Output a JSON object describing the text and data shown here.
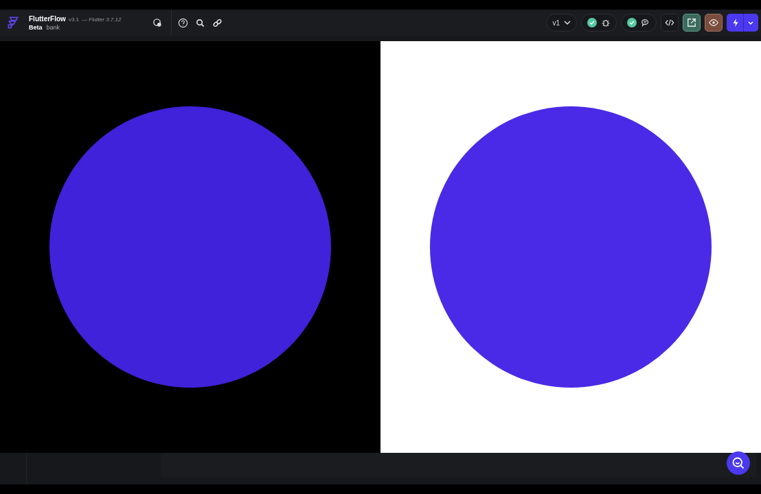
{
  "header": {
    "app_name": "FlutterFlow",
    "version": "v3.1",
    "flutter_version": "— Flutter 3.7.12",
    "badge": "Beta",
    "project": "bank",
    "branch": "v1"
  }
}
